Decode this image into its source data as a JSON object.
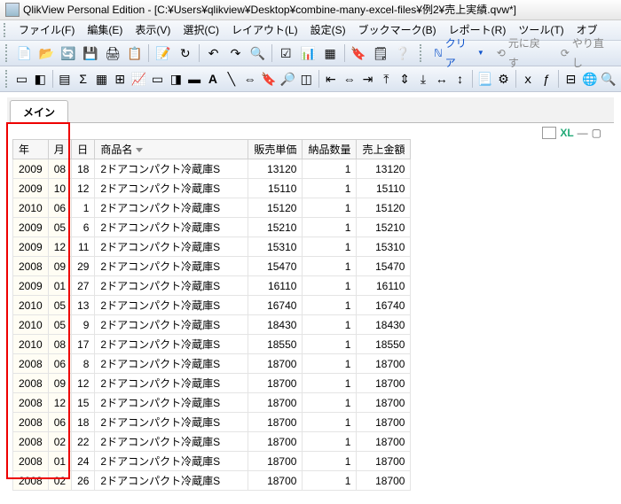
{
  "window": {
    "title": "QlikView Personal Edition - [C:¥Users¥qlikview¥Desktop¥combine-many-excel-files¥例2¥売上実績.qvw*]"
  },
  "menu": {
    "file": "ファイル(F)",
    "edit": "編集(E)",
    "view": "表示(V)",
    "select": "選択(C)",
    "layout": "レイアウト(L)",
    "settings": "設定(S)",
    "bookmark": "ブックマーク(B)",
    "report": "レポート(R)",
    "tools": "ツール(T)",
    "options": "オブ"
  },
  "toolbar": {
    "clear": "クリア",
    "undo": "元に戻す",
    "redo": "やり直し"
  },
  "tab": {
    "main": "メイン"
  },
  "grid_meta": {
    "xl": "XL"
  },
  "headers": {
    "year": "年",
    "month": "月",
    "day": "日",
    "product": "商品名",
    "unit_price": "販売単価",
    "qty": "納品数量",
    "amount": "売上金額"
  },
  "rows": [
    {
      "y": "2009",
      "m": "08",
      "d": "18",
      "p": "2ドアコンパクト冷蔵庫S",
      "u": "13120",
      "q": "1",
      "a": "13120"
    },
    {
      "y": "2009",
      "m": "10",
      "d": "12",
      "p": "2ドアコンパクト冷蔵庫S",
      "u": "15110",
      "q": "1",
      "a": "15110"
    },
    {
      "y": "2010",
      "m": "06",
      "d": "1",
      "p": "2ドアコンパクト冷蔵庫S",
      "u": "15120",
      "q": "1",
      "a": "15120"
    },
    {
      "y": "2009",
      "m": "05",
      "d": "6",
      "p": "2ドアコンパクト冷蔵庫S",
      "u": "15210",
      "q": "1",
      "a": "15210"
    },
    {
      "y": "2009",
      "m": "12",
      "d": "11",
      "p": "2ドアコンパクト冷蔵庫S",
      "u": "15310",
      "q": "1",
      "a": "15310"
    },
    {
      "y": "2008",
      "m": "09",
      "d": "29",
      "p": "2ドアコンパクト冷蔵庫S",
      "u": "15470",
      "q": "1",
      "a": "15470"
    },
    {
      "y": "2009",
      "m": "01",
      "d": "27",
      "p": "2ドアコンパクト冷蔵庫S",
      "u": "16110",
      "q": "1",
      "a": "16110"
    },
    {
      "y": "2010",
      "m": "05",
      "d": "13",
      "p": "2ドアコンパクト冷蔵庫S",
      "u": "16740",
      "q": "1",
      "a": "16740"
    },
    {
      "y": "2010",
      "m": "05",
      "d": "9",
      "p": "2ドアコンパクト冷蔵庫S",
      "u": "18430",
      "q": "1",
      "a": "18430"
    },
    {
      "y": "2010",
      "m": "08",
      "d": "17",
      "p": "2ドアコンパクト冷蔵庫S",
      "u": "18550",
      "q": "1",
      "a": "18550"
    },
    {
      "y": "2008",
      "m": "06",
      "d": "8",
      "p": "2ドアコンパクト冷蔵庫S",
      "u": "18700",
      "q": "1",
      "a": "18700"
    },
    {
      "y": "2008",
      "m": "09",
      "d": "12",
      "p": "2ドアコンパクト冷蔵庫S",
      "u": "18700",
      "q": "1",
      "a": "18700"
    },
    {
      "y": "2008",
      "m": "12",
      "d": "15",
      "p": "2ドアコンパクト冷蔵庫S",
      "u": "18700",
      "q": "1",
      "a": "18700"
    },
    {
      "y": "2008",
      "m": "06",
      "d": "18",
      "p": "2ドアコンパクト冷蔵庫S",
      "u": "18700",
      "q": "1",
      "a": "18700"
    },
    {
      "y": "2008",
      "m": "02",
      "d": "22",
      "p": "2ドアコンパクト冷蔵庫S",
      "u": "18700",
      "q": "1",
      "a": "18700"
    },
    {
      "y": "2008",
      "m": "01",
      "d": "24",
      "p": "2ドアコンパクト冷蔵庫S",
      "u": "18700",
      "q": "1",
      "a": "18700"
    },
    {
      "y": "2008",
      "m": "02",
      "d": "26",
      "p": "2ドアコンパクト冷蔵庫S",
      "u": "18700",
      "q": "1",
      "a": "18700"
    }
  ]
}
